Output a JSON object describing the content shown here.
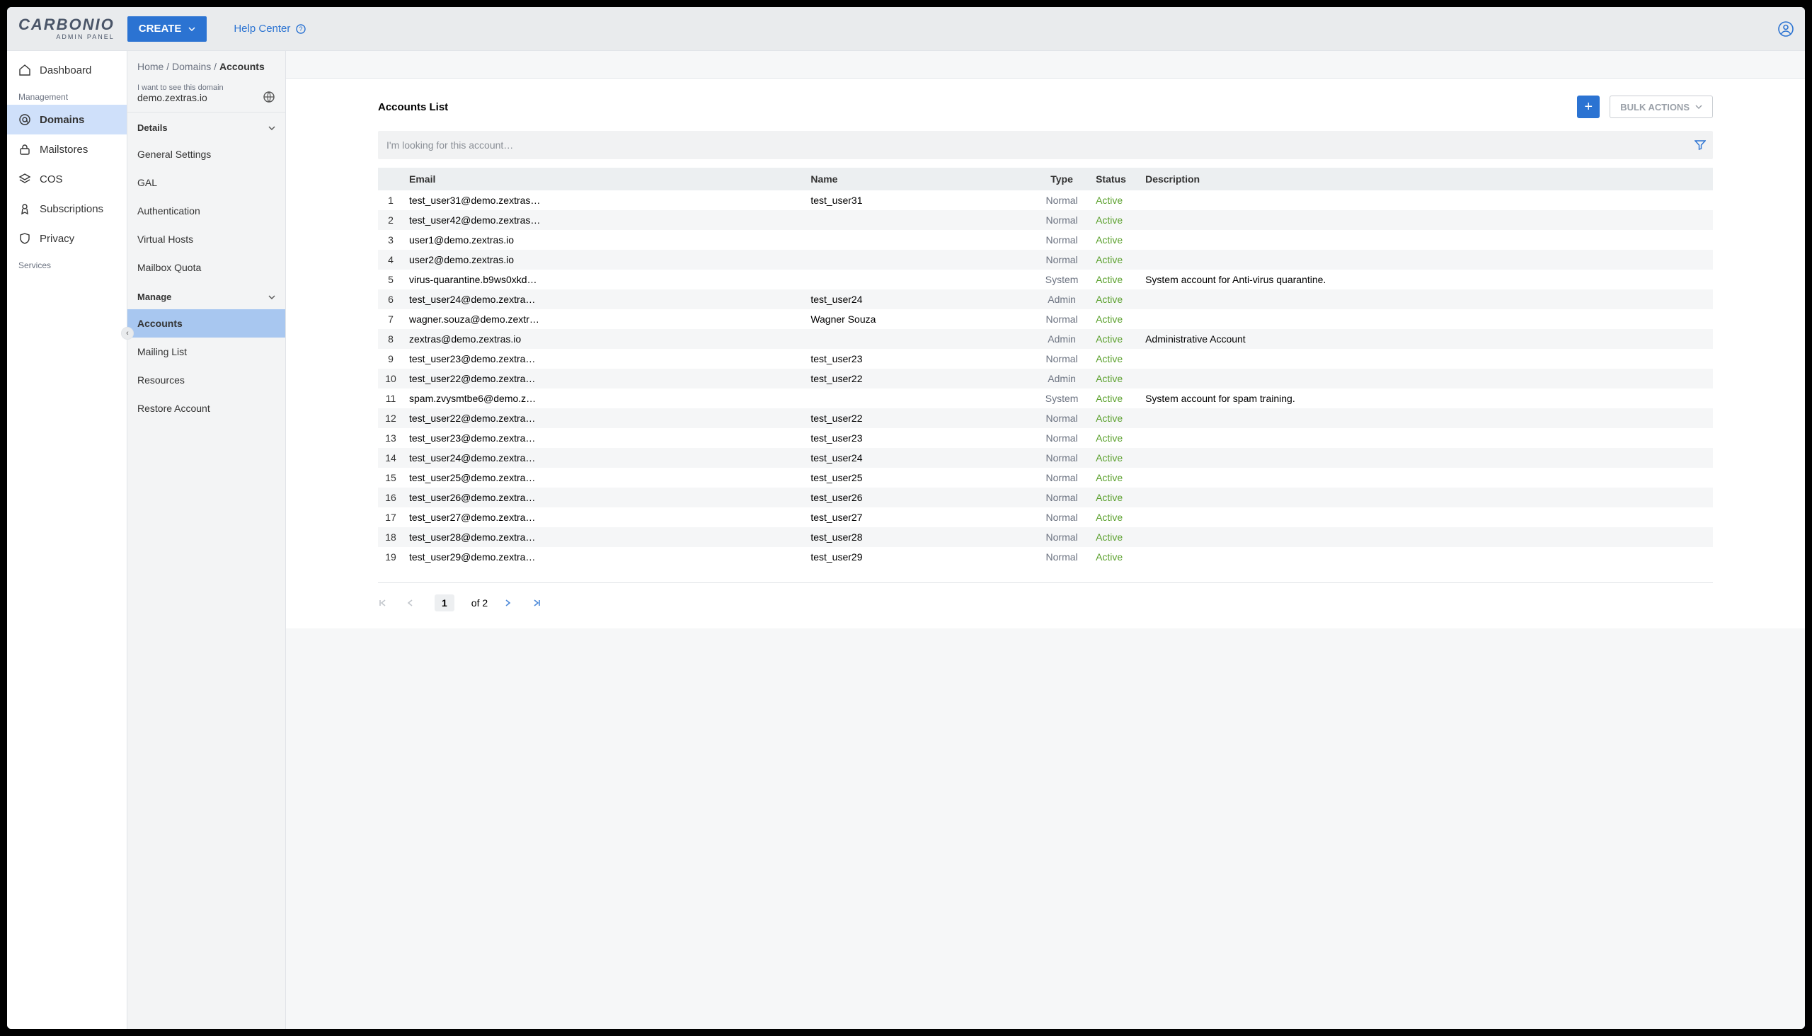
{
  "brand": {
    "main": "CARBONIO",
    "sub": "ADMIN PANEL"
  },
  "topbar": {
    "create_label": "CREATE",
    "help_label": "Help Center"
  },
  "sidebar": {
    "section_management": "Management",
    "section_services": "Services",
    "items": [
      {
        "label": "Dashboard"
      },
      {
        "label": "Domains"
      },
      {
        "label": "Mailstores"
      },
      {
        "label": "COS"
      },
      {
        "label": "Subscriptions"
      },
      {
        "label": "Privacy"
      }
    ]
  },
  "breadcrumb": {
    "home": "Home",
    "domains": "Domains",
    "accounts": "Accounts"
  },
  "domain_selector": {
    "label": "I want to see this domain",
    "value": "demo.zextras.io"
  },
  "subnav": {
    "details_head": "Details",
    "manage_head": "Manage",
    "details_items": [
      {
        "label": "General Settings"
      },
      {
        "label": "GAL"
      },
      {
        "label": "Authentication"
      },
      {
        "label": "Virtual Hosts"
      },
      {
        "label": "Mailbox Quota"
      }
    ],
    "manage_items": [
      {
        "label": "Accounts"
      },
      {
        "label": "Mailing List"
      },
      {
        "label": "Resources"
      },
      {
        "label": "Restore Account"
      }
    ]
  },
  "list": {
    "title": "Accounts List",
    "bulk_label": "BULK ACTIONS",
    "search_placeholder": "I'm looking for this account…",
    "columns": {
      "email": "Email",
      "name": "Name",
      "type": "Type",
      "status": "Status",
      "desc": "Description"
    },
    "rows": [
      {
        "idx": "1",
        "email": "test_user31@demo.zextras…",
        "name": "test_user31",
        "type": "Normal",
        "status": "Active",
        "desc": ""
      },
      {
        "idx": "2",
        "email": "test_user42@demo.zextras…",
        "name": "",
        "type": "Normal",
        "status": "Active",
        "desc": ""
      },
      {
        "idx": "3",
        "email": "user1@demo.zextras.io",
        "name": "",
        "type": "Normal",
        "status": "Active",
        "desc": ""
      },
      {
        "idx": "4",
        "email": "user2@demo.zextras.io",
        "name": "",
        "type": "Normal",
        "status": "Active",
        "desc": ""
      },
      {
        "idx": "5",
        "email": "virus-quarantine.b9ws0xkd…",
        "name": "",
        "type": "System",
        "status": "Active",
        "desc": "System account for Anti-virus quarantine."
      },
      {
        "idx": "6",
        "email": "test_user24@demo.zextra…",
        "name": "test_user24",
        "type": "Admin",
        "status": "Active",
        "desc": ""
      },
      {
        "idx": "7",
        "email": "wagner.souza@demo.zextr…",
        "name": "Wagner Souza",
        "type": "Normal",
        "status": "Active",
        "desc": ""
      },
      {
        "idx": "8",
        "email": "zextras@demo.zextras.io",
        "name": "",
        "type": "Admin",
        "status": "Active",
        "desc": "Administrative Account"
      },
      {
        "idx": "9",
        "email": "test_user23@demo.zextra…",
        "name": "test_user23",
        "type": "Normal",
        "status": "Active",
        "desc": ""
      },
      {
        "idx": "10",
        "email": "test_user22@demo.zextra…",
        "name": "test_user22",
        "type": "Admin",
        "status": "Active",
        "desc": ""
      },
      {
        "idx": "11",
        "email": "spam.zvysmtbe6@demo.z…",
        "name": "",
        "type": "System",
        "status": "Active",
        "desc": "System account for spam training."
      },
      {
        "idx": "12",
        "email": "test_user22@demo.zextra…",
        "name": "test_user22",
        "type": "Normal",
        "status": "Active",
        "desc": ""
      },
      {
        "idx": "13",
        "email": "test_user23@demo.zextra…",
        "name": "test_user23",
        "type": "Normal",
        "status": "Active",
        "desc": ""
      },
      {
        "idx": "14",
        "email": "test_user24@demo.zextra…",
        "name": "test_user24",
        "type": "Normal",
        "status": "Active",
        "desc": ""
      },
      {
        "idx": "15",
        "email": "test_user25@demo.zextra…",
        "name": "test_user25",
        "type": "Normal",
        "status": "Active",
        "desc": ""
      },
      {
        "idx": "16",
        "email": "test_user26@demo.zextra…",
        "name": "test_user26",
        "type": "Normal",
        "status": "Active",
        "desc": ""
      },
      {
        "idx": "17",
        "email": "test_user27@demo.zextra…",
        "name": "test_user27",
        "type": "Normal",
        "status": "Active",
        "desc": ""
      },
      {
        "idx": "18",
        "email": "test_user28@demo.zextra…",
        "name": "test_user28",
        "type": "Normal",
        "status": "Active",
        "desc": ""
      },
      {
        "idx": "19",
        "email": "test_user29@demo.zextra…",
        "name": "test_user29",
        "type": "Normal",
        "status": "Active",
        "desc": ""
      }
    ]
  },
  "paginator": {
    "current": "1",
    "of_label": "of 2"
  }
}
